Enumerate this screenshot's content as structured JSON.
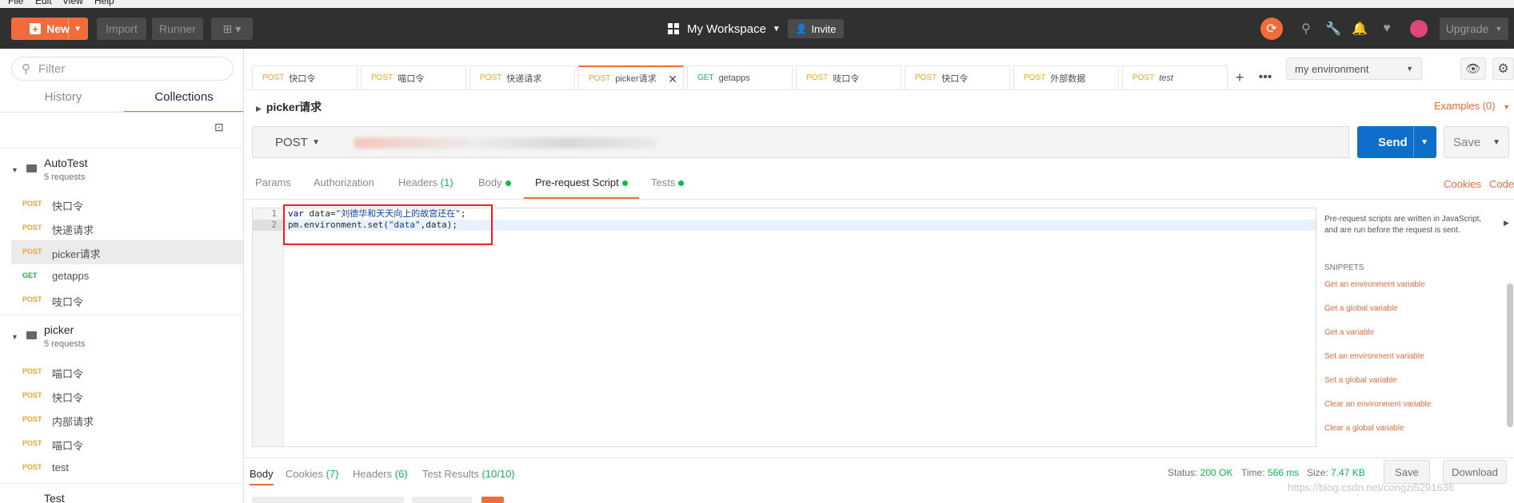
{
  "menu": [
    "File",
    "Edit",
    "View",
    "Help"
  ],
  "header": {
    "new_label": "New",
    "import_label": "Import",
    "runner_label": "Runner",
    "workspace_label": "My Workspace",
    "invite_label": "Invite",
    "upgrade_label": "Upgrade"
  },
  "sidebar": {
    "filter_placeholder": "Filter",
    "tabs": [
      "History",
      "Collections"
    ],
    "collections": [
      {
        "name": "AutoTest",
        "count": "5 requests",
        "requests": [
          {
            "method": "POST",
            "name": "快口令"
          },
          {
            "method": "POST",
            "name": "快递请求"
          },
          {
            "method": "POST",
            "name": "picker请求"
          },
          {
            "method": "GET",
            "name": "getapps"
          },
          {
            "method": "POST",
            "name": "吱口令"
          }
        ]
      },
      {
        "name": "picker",
        "count": "5 requests",
        "requests": [
          {
            "method": "POST",
            "name": "喵口令"
          },
          {
            "method": "POST",
            "name": "快口令"
          },
          {
            "method": "POST",
            "name": "内部请求"
          },
          {
            "method": "POST",
            "name": "喵口令"
          },
          {
            "method": "POST",
            "name": "test"
          }
        ]
      },
      {
        "name": "Test"
      }
    ]
  },
  "tabs": [
    {
      "method": "POST",
      "name": "快口令"
    },
    {
      "method": "POST",
      "name": "喵口令"
    },
    {
      "method": "POST",
      "name": "快递请求"
    },
    {
      "method": "POST",
      "name": "picker请求"
    },
    {
      "method": "GET",
      "name": "getapps"
    },
    {
      "method": "POST",
      "name": "吱口令"
    },
    {
      "method": "POST",
      "name": "快口令"
    },
    {
      "method": "POST",
      "name": "外部数据"
    },
    {
      "method": "POST",
      "name": "test"
    }
  ],
  "environment": {
    "selected": "my environment"
  },
  "request": {
    "title": "picker请求",
    "examples_label": "Examples (0)",
    "method": "POST",
    "send_label": "Send",
    "save_label": "Save"
  },
  "request_tabs": {
    "params": "Params",
    "authorization": "Authorization",
    "headers": "Headers",
    "headers_count": "(1)",
    "body": "Body",
    "prerequest": "Pre-request Script",
    "tests": "Tests",
    "cookies": "Cookies",
    "code": "Code"
  },
  "editor": {
    "line_numbers": [
      "1",
      "2"
    ],
    "line1": {
      "kw": "var",
      "plain": " data=",
      "str": "\"刘德华和天天向上的故宫还在\"",
      "end": ";"
    },
    "line2": {
      "plain1": "pm.environment.set(",
      "str": "\"data\"",
      "plain2": ",data);"
    }
  },
  "help": {
    "description": "Pre-request scripts are written in JavaScript, and are run before the request is sent.",
    "snippets_title": "SNIPPETS",
    "snippets": [
      "Get an environment variable",
      "Get a global variable",
      "Get a variable",
      "Set an environment variable",
      "Set a global variable",
      "Clear an environment variable",
      "Clear a global variable"
    ]
  },
  "response": {
    "body": "Body",
    "cookies": "Cookies",
    "cookies_count": "(7)",
    "headers": "Headers",
    "headers_count": "(6)",
    "tests": "Test Results",
    "tests_count": "(10/10)",
    "status_label": "Status:",
    "status_value": "200 OK",
    "time_label": "Time:",
    "time_value": "566 ms",
    "size_label": "Size:",
    "size_value": "7.47 KB",
    "save_label": "Save",
    "download_label": "Download"
  },
  "watermark": "https://blog.csdn.net/congzi5291636",
  "colors": {
    "accent": "#f26b3a",
    "send": "#0f6ec9",
    "post": "#f5a623",
    "get": "#0cbb52"
  }
}
